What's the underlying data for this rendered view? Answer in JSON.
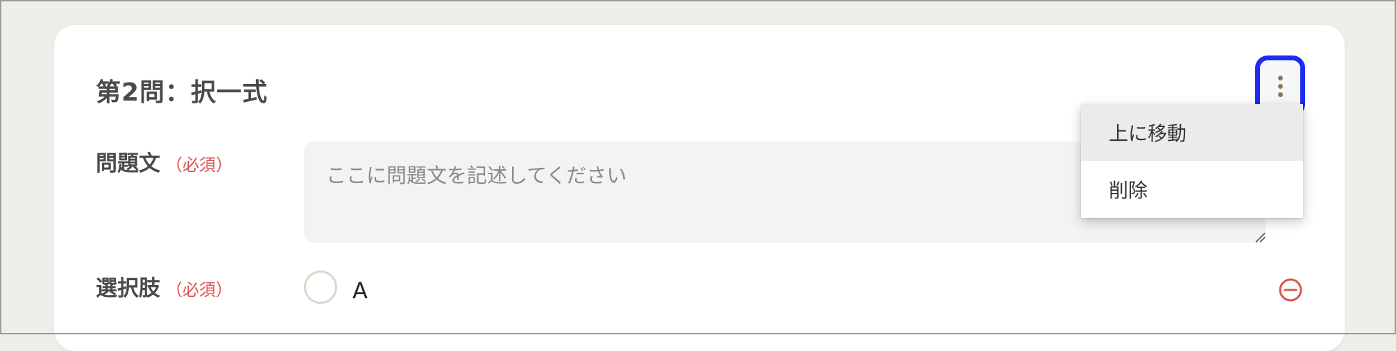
{
  "question": {
    "title": "第2問：択一式",
    "question_label": "問題文",
    "choices_label": "選択肢",
    "required_badge": "（必須）",
    "textarea_placeholder": "ここに問題文を記述してください",
    "textarea_value": ""
  },
  "choices": [
    {
      "text": "A",
      "selected": false
    }
  ],
  "menu": {
    "items": [
      {
        "label": "上に移動",
        "highlighted": true
      },
      {
        "label": "削除",
        "highlighted": false
      }
    ]
  },
  "icons": {
    "kebab": "more-vertical-icon",
    "remove": "remove-circle-icon",
    "resize": "resize-grip-icon"
  },
  "colors": {
    "required": "#d9534f",
    "focus_ring": "#1d2cf0",
    "remove": "#d9534f",
    "background": "#efeee9"
  }
}
